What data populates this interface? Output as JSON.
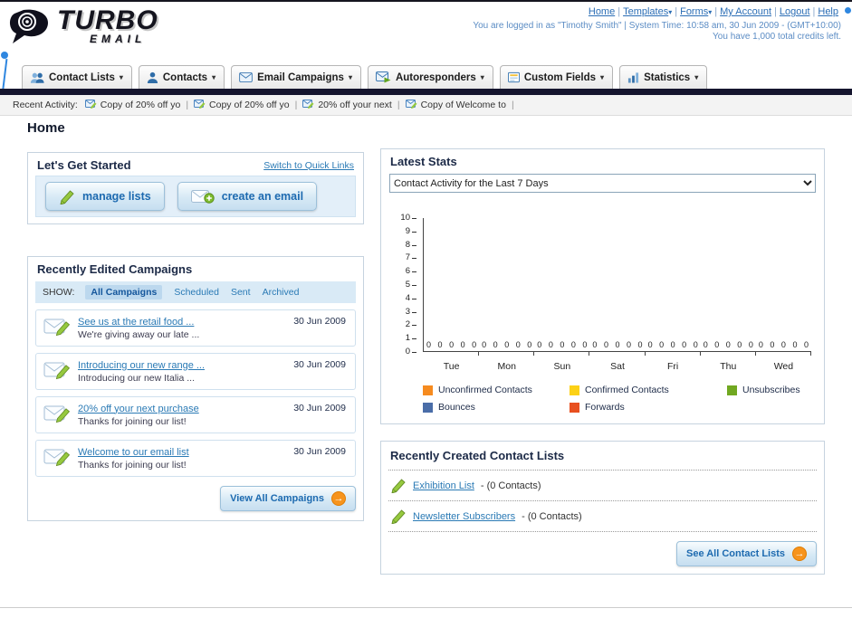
{
  "header": {
    "logo_title": "TURBO",
    "logo_subtitle": "EMAIL",
    "nav_links": [
      {
        "label": "Home",
        "has_menu": false
      },
      {
        "label": "Templates",
        "has_menu": true
      },
      {
        "label": "Forms",
        "has_menu": true
      },
      {
        "label": "My Account",
        "has_menu": false
      },
      {
        "label": "Logout",
        "has_menu": false
      },
      {
        "label": "Help",
        "has_menu": false
      }
    ],
    "login_info": "You are logged in as \"Timothy Smith\" | System Time: 10:58 am, 30 Jun 2009 - (GMT+10:00)",
    "credits_info": "You have 1,000 total credits left."
  },
  "main_nav": [
    {
      "label": "Contact Lists",
      "icon": "contact-lists-icon"
    },
    {
      "label": "Contacts",
      "icon": "contacts-icon"
    },
    {
      "label": "Email Campaigns",
      "icon": "email-campaigns-icon"
    },
    {
      "label": "Autoresponders",
      "icon": "autoresponders-icon"
    },
    {
      "label": "Custom Fields",
      "icon": "custom-fields-icon"
    },
    {
      "label": "Statistics",
      "icon": "statistics-icon"
    }
  ],
  "recent_activity": {
    "label": "Recent Activity:",
    "items": [
      "Copy of 20% off yo",
      "Copy of 20% off yo",
      "20% off your next",
      "Copy of Welcome to"
    ]
  },
  "page": {
    "title": "Home"
  },
  "get_started": {
    "title": "Let's Get Started",
    "switch_link": "Switch to Quick Links",
    "buttons": [
      {
        "label": "manage lists",
        "icon": "pencil-icon"
      },
      {
        "label": "create an email",
        "icon": "envelope-plus-icon"
      }
    ]
  },
  "campaigns": {
    "title": "Recently Edited Campaigns",
    "show_label": "SHOW:",
    "filters": [
      "All Campaigns",
      "Scheduled",
      "Sent",
      "Archived"
    ],
    "active_filter": "All Campaigns",
    "items": [
      {
        "title": "See us at the retail food ...",
        "subtitle": "We're giving away our late ...",
        "date": "30 Jun 2009"
      },
      {
        "title": "Introducing our new range ...",
        "subtitle": "Introducing our new Italia ...",
        "date": "30 Jun 2009"
      },
      {
        "title": "20% off your next purchase",
        "subtitle": "Thanks for joining our list!",
        "date": "30 Jun 2009"
      },
      {
        "title": "Welcome to our email list",
        "subtitle": "Thanks for joining our list!",
        "date": "30 Jun 2009"
      }
    ],
    "view_all_label": "View All Campaigns"
  },
  "stats": {
    "title": "Latest Stats",
    "dropdown_value": "Contact Activity for the Last 7 Days"
  },
  "chart_data": {
    "type": "bar",
    "title": "Contact Activity for the Last 7 Days",
    "categories": [
      "Tue",
      "Mon",
      "Sun",
      "Sat",
      "Fri",
      "Thu",
      "Wed"
    ],
    "series": [
      {
        "name": "Unconfirmed Contacts",
        "color": "#f68b1f",
        "values": [
          0,
          0,
          0,
          0,
          0,
          0,
          0
        ]
      },
      {
        "name": "Confirmed Contacts",
        "color": "#fcd116",
        "values": [
          0,
          0,
          0,
          0,
          0,
          0,
          0
        ]
      },
      {
        "name": "Unsubscribes",
        "color": "#71a821",
        "values": [
          0,
          0,
          0,
          0,
          0,
          0,
          0
        ]
      },
      {
        "name": "Bounces",
        "color": "#4a6da8",
        "values": [
          0,
          0,
          0,
          0,
          0,
          0,
          0
        ]
      },
      {
        "name": "Forwards",
        "color": "#e8501f",
        "values": [
          0,
          0,
          0,
          0,
          0,
          0,
          0
        ]
      }
    ],
    "ylim": [
      0,
      10
    ],
    "yticks": [
      10,
      9,
      8,
      7,
      6,
      5,
      4,
      3,
      2,
      1,
      0
    ],
    "grid": false,
    "legend_position": "bottom"
  },
  "contact_lists": {
    "title": "Recently Created Contact Lists",
    "items": [
      {
        "name": "Exhibition List",
        "detail": "- (0 Contacts)"
      },
      {
        "name": "Newsletter Subscribers",
        "detail": "- (0 Contacts)"
      }
    ],
    "see_all_label": "See All Contact Lists"
  },
  "colors": {
    "link": "#2a6db5",
    "accent_orange": "#f7941d",
    "nav_bar_dark": "#15152e",
    "panel_border": "#c6d3df"
  }
}
